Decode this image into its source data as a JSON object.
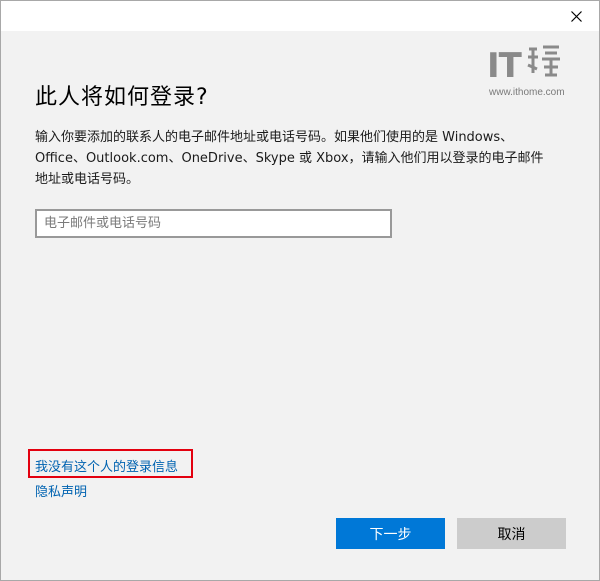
{
  "window": {
    "close_icon": "close-icon",
    "watermark": {
      "logo_text": "IT",
      "url": "www.ithome.com"
    }
  },
  "dialog": {
    "heading": "此人将如何登录?",
    "description": "输入你要添加的联系人的电子邮件地址或电话号码。如果他们使用的是 Windows、Office、Outlook.com、OneDrive、Skype 或 Xbox，请输入他们用以登录的电子邮件地址或电话号码。",
    "email_input": {
      "placeholder": "电子邮件或电话号码",
      "value": ""
    },
    "no_info_link": "我没有这个人的登录信息",
    "privacy_link": "隐私声明",
    "next_button": "下一步",
    "cancel_button": "取消"
  },
  "colors": {
    "accent": "#0078d7",
    "link": "#0063b1",
    "highlight": "#e3000f",
    "background": "#f2f2f2"
  }
}
